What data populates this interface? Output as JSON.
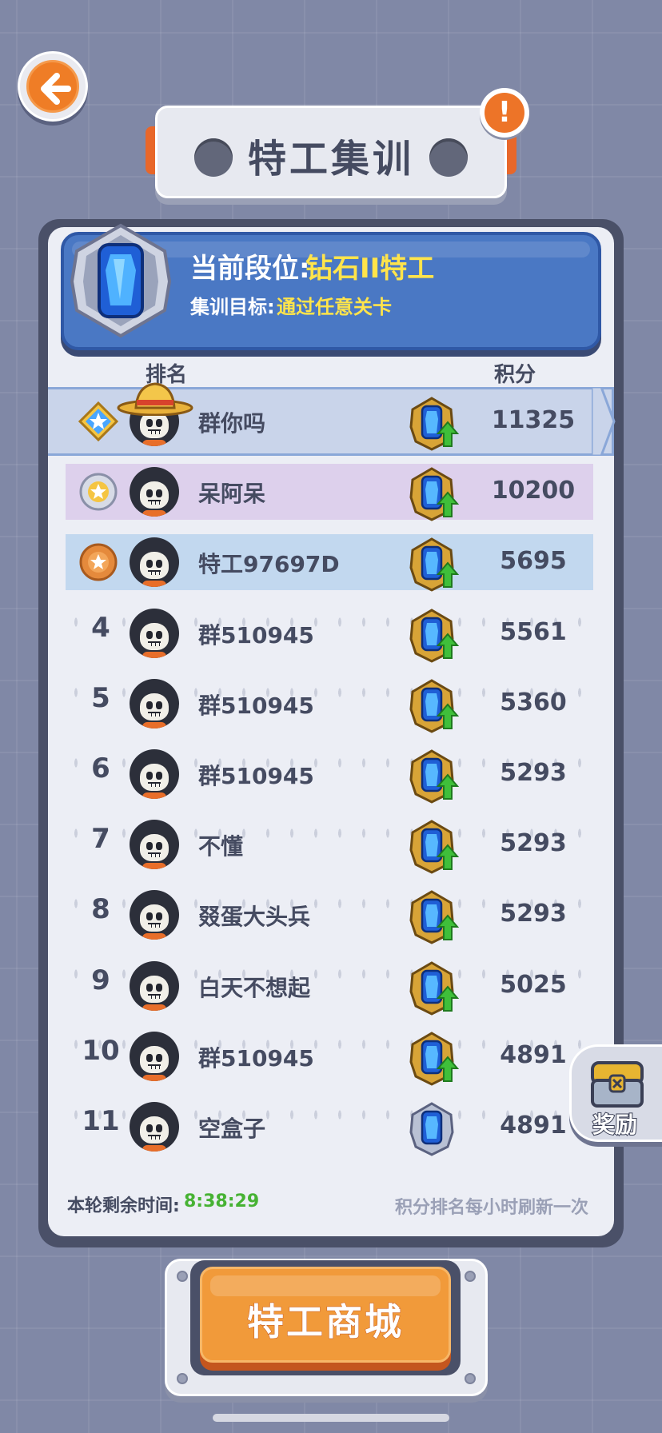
{
  "header": {
    "title": "特工集训",
    "back_icon": "arrow-left-icon",
    "info_icon_text": "!"
  },
  "banner": {
    "rank_label": "当前段位:",
    "rank_value": "钻石II特工",
    "goal_label": "集训目标:",
    "goal_value": "通过任意关卡"
  },
  "columns": {
    "rank": "排名",
    "score": "积分"
  },
  "rows": [
    {
      "rank": "1",
      "name": "群你吗",
      "score": "11325",
      "medal": "diamond-star",
      "badge": "gold-diamond-up"
    },
    {
      "rank": "2",
      "name": "呆阿呆",
      "score": "10200",
      "medal": "silver",
      "badge": "gold-diamond-up"
    },
    {
      "rank": "3",
      "name": "特工97697D",
      "score": "5695",
      "medal": "bronze",
      "badge": "gold-diamond-up"
    },
    {
      "rank": "4",
      "name": "群510945",
      "score": "5561",
      "badge": "gold-diamond-up"
    },
    {
      "rank": "5",
      "name": "群510945",
      "score": "5360",
      "badge": "gold-diamond-up"
    },
    {
      "rank": "6",
      "name": "群510945",
      "score": "5293",
      "badge": "gold-diamond-up"
    },
    {
      "rank": "7",
      "name": "不懂",
      "score": "5293",
      "badge": "gold-diamond-up"
    },
    {
      "rank": "8",
      "name": "叕蛋大头兵",
      "score": "5293",
      "badge": "gold-diamond-up"
    },
    {
      "rank": "9",
      "name": "白天不想起",
      "score": "5025",
      "badge": "gold-diamond-up"
    },
    {
      "rank": "10",
      "name": "群510945",
      "score": "4891",
      "badge": "gold-diamond-up"
    },
    {
      "rank": "11",
      "name": "空盒子",
      "score": "4891",
      "badge": "silver-diamond"
    }
  ],
  "footer": {
    "timer_label": "本轮剩余时间:",
    "timer_value": "8:38:29",
    "refresh_note": "积分排名每小时刷新一次"
  },
  "reward": {
    "label": "奖励"
  },
  "shop": {
    "label": "特工商城"
  },
  "colors": {
    "accent_orange": "#ef7d26",
    "banner_blue": "#4a78c4",
    "highlight_yellow": "#ffe44b",
    "timer_green": "#46b233",
    "row2_bg": "#ddd0ec",
    "row3_bg": "#c2d8ef"
  }
}
